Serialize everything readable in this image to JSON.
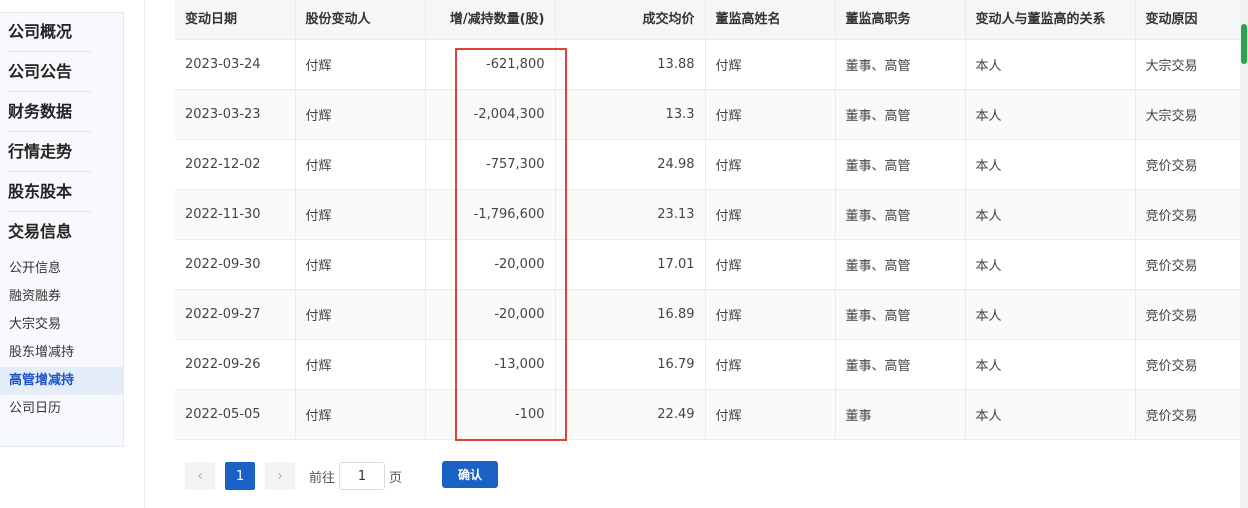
{
  "sidebar": {
    "main_items": [
      "公司概况",
      "公司公告",
      "财务数据",
      "行情走势",
      "股东股本",
      "交易信息"
    ],
    "sub_items": [
      "公开信息",
      "融资融券",
      "大宗交易",
      "股东增减持",
      "高管增减持",
      "公司日历"
    ],
    "active_sub": "高管增减持"
  },
  "table": {
    "columns": [
      "变动日期",
      "股份变动人",
      "增/减持数量(股)",
      "成交均价",
      "董监高姓名",
      "董监高职务",
      "变动人与董监高的关系",
      "变动原因"
    ],
    "rows": [
      [
        "2023-03-24",
        "付辉",
        "-621,800",
        "13.88",
        "付辉",
        "董事、高管",
        "本人",
        "大宗交易"
      ],
      [
        "2023-03-23",
        "付辉",
        "-2,004,300",
        "13.3",
        "付辉",
        "董事、高管",
        "本人",
        "大宗交易"
      ],
      [
        "2022-12-02",
        "付辉",
        "-757,300",
        "24.98",
        "付辉",
        "董事、高管",
        "本人",
        "竞价交易"
      ],
      [
        "2022-11-30",
        "付辉",
        "-1,796,600",
        "23.13",
        "付辉",
        "董事、高管",
        "本人",
        "竞价交易"
      ],
      [
        "2022-09-30",
        "付辉",
        "-20,000",
        "17.01",
        "付辉",
        "董事、高管",
        "本人",
        "竞价交易"
      ],
      [
        "2022-09-27",
        "付辉",
        "-20,000",
        "16.89",
        "付辉",
        "董事、高管",
        "本人",
        "竞价交易"
      ],
      [
        "2022-09-26",
        "付辉",
        "-13,000",
        "16.79",
        "付辉",
        "董事、高管",
        "本人",
        "竞价交易"
      ],
      [
        "2022-05-05",
        "付辉",
        "-100",
        "22.49",
        "付辉",
        "董事",
        "本人",
        "竞价交易"
      ]
    ]
  },
  "pagination": {
    "prev_icon": "chevron-left-icon",
    "next_icon": "chevron-right-icon",
    "prev_glyph": "‹",
    "next_glyph": "›",
    "current_page": "1",
    "goto_prefix": "前往",
    "goto_value": "1",
    "goto_suffix": "页",
    "confirm_label": "确认"
  },
  "colors": {
    "accent": "#1a61c5",
    "highlight_border": "#e0403a",
    "scroll_thumb": "#2ea44f"
  }
}
